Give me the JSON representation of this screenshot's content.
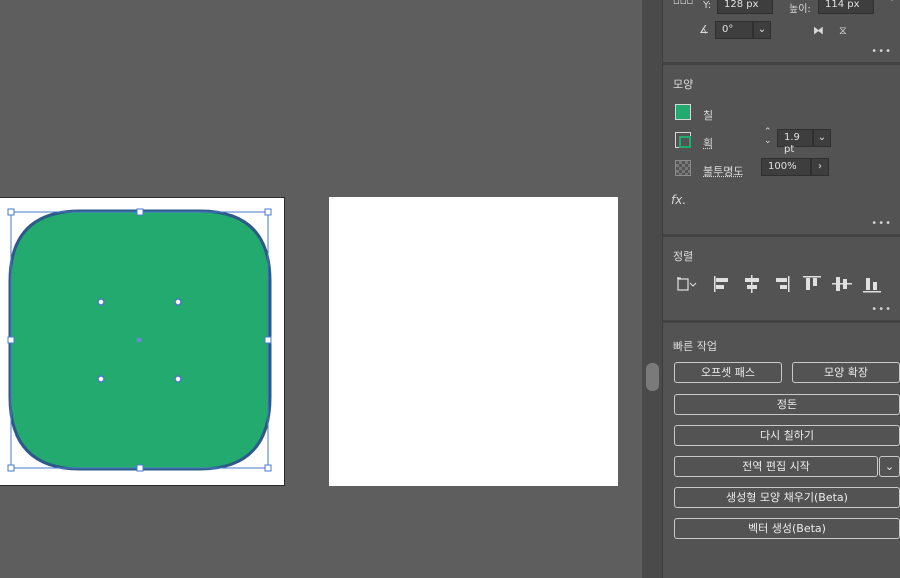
{
  "transform": {
    "y_label": "Y:",
    "y_value": "128 px",
    "height_label": "높이:",
    "height_value": "114 px",
    "angle_value": "0°"
  },
  "appearance": {
    "title": "모양",
    "fill_label": "칠",
    "stroke_label": "획",
    "stroke_value": "1.9 pt",
    "opacity_label": "불투명도",
    "opacity_value": "100%",
    "fill_color": "#23ab6f"
  },
  "align": {
    "title": "정렬"
  },
  "quick_actions": {
    "title": "빠른 작업",
    "offset_path": "오프셋 패스",
    "expand_shape": "모양 확장",
    "arrange": "정돈",
    "recolor": "다시 칠하기",
    "global_edit": "전역 편집 시작",
    "generative_fill": "생성형 모양 채우기(Beta)",
    "generate_vector": "벡터 생성(Beta)"
  },
  "more_label": "•••",
  "fx_label": "fx."
}
